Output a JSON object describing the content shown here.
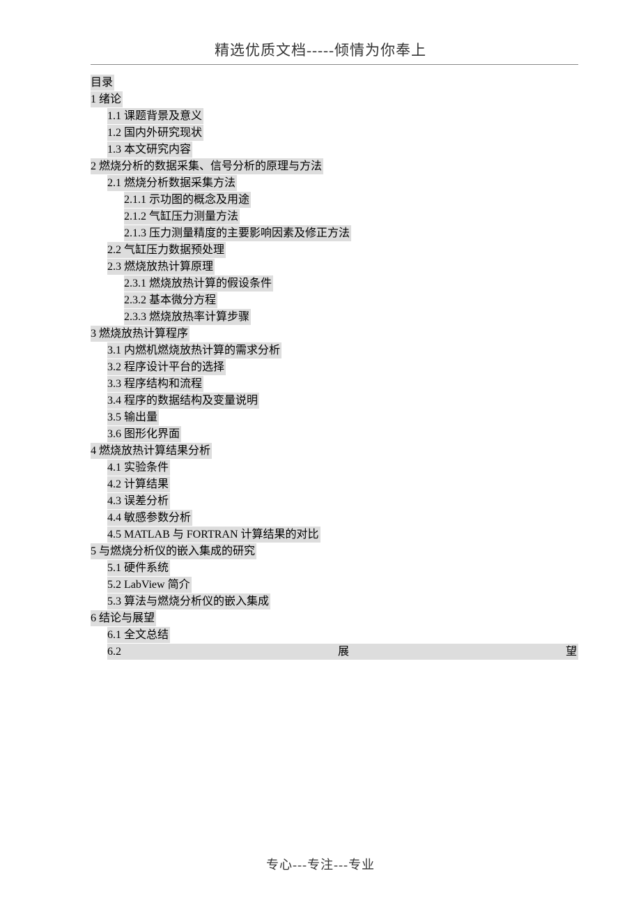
{
  "header": "精选优质文档-----倾情为你奉上",
  "footer": "专心---专注---专业",
  "toc": [
    {
      "level": 0,
      "text": "目录"
    },
    {
      "level": 0,
      "text": "1 绪论"
    },
    {
      "level": 1,
      "text": "1.1 课题背景及意义"
    },
    {
      "level": 1,
      "text": "1.2 国内外研究现状"
    },
    {
      "level": 1,
      "text": "1.3 本文研究内容"
    },
    {
      "level": 0,
      "text": "2 燃烧分析的数据采集、信号分析的原理与方法"
    },
    {
      "level": 1,
      "text": "2.1 燃烧分析数据采集方法"
    },
    {
      "level": 2,
      "text": "2.1.1 示功图的概念及用途"
    },
    {
      "level": 2,
      "text": "2.1.2 气缸压力测量方法"
    },
    {
      "level": 2,
      "text": "2.1.3 压力测量精度的主要影响因素及修正方法"
    },
    {
      "level": 1,
      "text": "2.2 气缸压力数据预处理"
    },
    {
      "level": 1,
      "text": "2.3 燃烧放热计算原理"
    },
    {
      "level": 2,
      "text": "2.3.1 燃烧放热计算的假设条件"
    },
    {
      "level": 2,
      "text": "2.3.2 基本微分方程"
    },
    {
      "level": 2,
      "text": "2.3.3 燃烧放热率计算步骤"
    },
    {
      "level": 0,
      "text": "3 燃烧放热计算程序"
    },
    {
      "level": 1,
      "text": "3.1 内燃机燃烧放热计算的需求分析"
    },
    {
      "level": 1,
      "text": "3.2 程序设计平台的选择"
    },
    {
      "level": 1,
      "text": "3.3 程序结构和流程"
    },
    {
      "level": 1,
      "text": "3.4 程序的数据结构及变量说明"
    },
    {
      "level": 1,
      "text": "3.5 输出量"
    },
    {
      "level": 1,
      "text": "3.6 图形化界面"
    },
    {
      "level": 0,
      "text": "4 燃烧放热计算结果分析"
    },
    {
      "level": 1,
      "text": "4.1 实验条件"
    },
    {
      "level": 1,
      "text": "4.2 计算结果"
    },
    {
      "level": 1,
      "text": "4.3 误差分析"
    },
    {
      "level": 1,
      "text": "4.4 敏感参数分析"
    },
    {
      "level": 1,
      "text": "4.5 MATLAB 与 FORTRAN 计算结果的对比"
    },
    {
      "level": 0,
      "text": "5 与燃烧分析仪的嵌入集成的研究"
    },
    {
      "level": 1,
      "text": "5.1 硬件系统"
    },
    {
      "level": 1,
      "text": "5.2 LabView 简介"
    },
    {
      "level": 1,
      "text": "5.3 算法与燃烧分析仪的嵌入集成"
    },
    {
      "level": 0,
      "text": "6 结论与展望"
    },
    {
      "level": 1,
      "text": "6.1 全文总结"
    }
  ],
  "toc_last": {
    "level": 1,
    "left": "6.2",
    "mid": "展",
    "right": "望"
  }
}
